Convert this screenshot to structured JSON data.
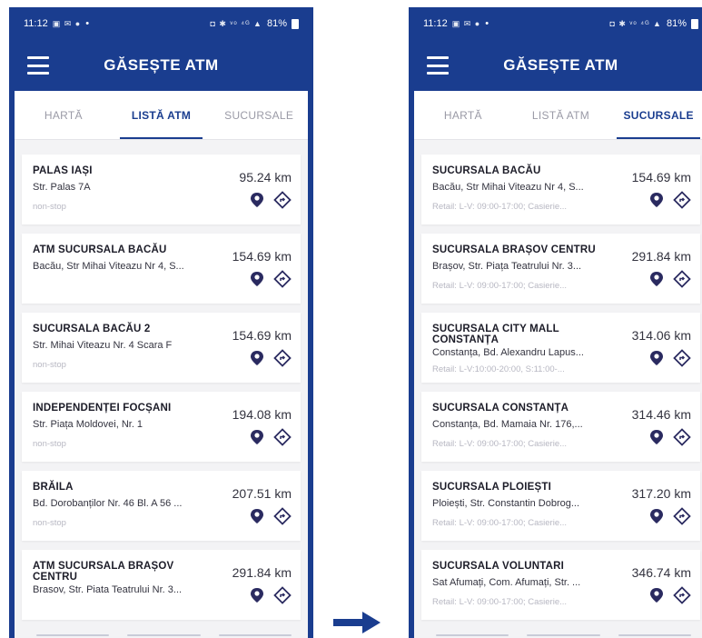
{
  "left": {
    "status": {
      "time": "11:12",
      "notif_icons": "▣ ✉ ●",
      "dot": "•",
      "right_icons": "◘ ✱ ᵛᵒ ⁴ᴳ ▲",
      "battery": "81%"
    },
    "app_title": "GĂSEȘTE ATM",
    "tabs": [
      {
        "label": "HARTĂ"
      },
      {
        "label": "LISTĂ ATM"
      },
      {
        "label": "SUCURSALE"
      }
    ],
    "items": [
      {
        "title": "PALAS IAȘI",
        "address": "Str. Palas 7A",
        "sub": "non-stop",
        "distance": "95.24 km"
      },
      {
        "title": "ATM SUCURSALA BACĂU",
        "address": "Bacău, Str Mihai Viteazu Nr 4, S...",
        "sub": "",
        "distance": "154.69 km"
      },
      {
        "title": "SUCURSALA BACĂU 2",
        "address": "Str. Mihai Viteazu Nr. 4 Scara F",
        "sub": "non-stop",
        "distance": "154.69 km"
      },
      {
        "title": "INDEPENDENȚEI FOCȘANI",
        "address": "Str. Piața Moldovei, Nr. 1",
        "sub": "non-stop",
        "distance": "194.08 km"
      },
      {
        "title": "BRĂILA",
        "address": "Bd. Dorobanților Nr. 46 Bl. A 56 ...",
        "sub": "non-stop",
        "distance": "207.51 km"
      },
      {
        "title": "ATM SUCURSALA BRAȘOV CENTRU",
        "address": "Brasov, Str. Piata Teatrului Nr. 3...",
        "sub": "",
        "distance": "291.84 km"
      }
    ]
  },
  "right": {
    "status": {
      "time": "11:12",
      "notif_icons": "▣ ✉ ●",
      "dot": "•",
      "right_icons": "◘ ✱ ᵛᵒ ⁴ᴳ ▲",
      "battery": "81%"
    },
    "app_title": "GĂSEȘTE ATM",
    "tabs": [
      {
        "label": "HARTĂ"
      },
      {
        "label": "LISTĂ ATM"
      },
      {
        "label": "SUCURSALE"
      }
    ],
    "items": [
      {
        "title": "SUCURSALA BACĂU",
        "address": "Bacău, Str Mihai Viteazu Nr 4, S...",
        "sub": "Retail: L-V: 09:00-17:00; Casierie...",
        "distance": "154.69 km"
      },
      {
        "title": "SUCURSALA BRAȘOV CENTRU",
        "address": "Brașov, Str. Piața Teatrului Nr. 3...",
        "sub": "Retail: L-V: 09:00-17:00; Casierie...",
        "distance": "291.84 km"
      },
      {
        "title": "SUCURSALA CITY MALL CONSTANȚA",
        "address": "Constanța, Bd. Alexandru Lapus...",
        "sub": "Retail: L-V:10:00-20:00, S:11:00-...",
        "distance": "314.06 km"
      },
      {
        "title": "SUCURSALA CONSTANȚA",
        "address": "Constanța, Bd. Mamaia Nr. 176,...",
        "sub": "Retail: L-V: 09:00-17:00; Casierie...",
        "distance": "314.46 km"
      },
      {
        "title": "SUCURSALA PLOIEȘTI",
        "address": "Ploiești, Str. Constantin Dobrog...",
        "sub": "Retail: L-V: 09:00-17:00; Casierie...",
        "distance": "317.20 km"
      },
      {
        "title": "SUCURSALA VOLUNTARI",
        "address": "Sat Afumați, Com. Afumați, Str. ...",
        "sub": "Retail: L-V: 09:00-17:00; Casierie...",
        "distance": "346.74 km"
      }
    ]
  },
  "colors": {
    "brand": "#1a3d8f",
    "card": "#ffffff",
    "background": "#f3f3f5",
    "pin": "#2a2a60"
  },
  "icons": {
    "menu": "hamburger-icon",
    "detail": "location-pin-icon",
    "navigate": "directions-icon",
    "between": "arrow-right-icon"
  }
}
